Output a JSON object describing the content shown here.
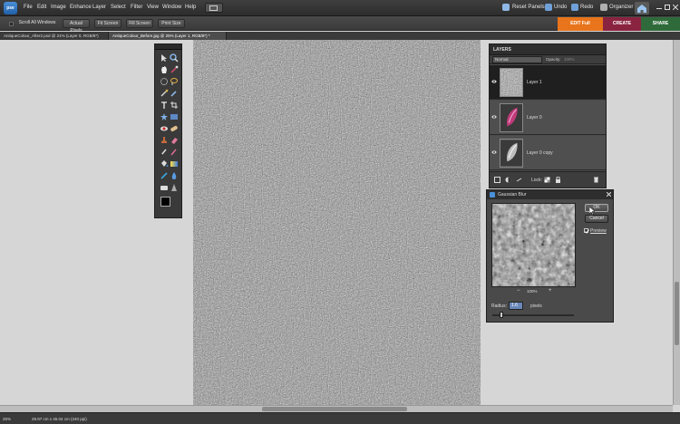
{
  "app": {
    "logo": "pse"
  },
  "menu": [
    "File",
    "Edit",
    "Image",
    "Enhance",
    "Layer",
    "Select",
    "Filter",
    "View",
    "Window",
    "Help"
  ],
  "top_right": {
    "reset_panels": "Reset Panels",
    "undo": "Undo",
    "redo": "Redo",
    "organizer": "Organizer"
  },
  "options_bar": {
    "scroll_all_windows": "Scroll All Windows",
    "actual_pixels": "Actual Pixels",
    "fit_screen": "Fit Screen",
    "fill_screen": "Fill Screen",
    "print_size": "Print Size"
  },
  "modes": {
    "edit_full": "EDIT Full",
    "create": "CREATE",
    "share": "SHARE"
  },
  "tabs": [
    {
      "label": "AntiqueColour_After2.psd @ 21% (Layer 0, RGB/8*)"
    },
    {
      "label": "AntiqueColour_Before.jpg @ 25% (Layer 1, RGB/8*) *"
    }
  ],
  "status": {
    "zoom": "25%",
    "info": "29.97 cm x 45.04 cm (240 ppi)"
  },
  "layers": {
    "title": "LAYERS",
    "blend_mode": "Normal",
    "opacity_label": "Opacity:",
    "opacity_value": "100%",
    "lock_label": "Lock:",
    "items": [
      {
        "name": "Layer 1",
        "selected": true
      },
      {
        "name": "Layer 0",
        "selected": false
      },
      {
        "name": "Layer 0 copy",
        "selected": false
      }
    ]
  },
  "gaussian_blur": {
    "title": "Gaussian Blur",
    "ok": "OK",
    "cancel": "Cancel",
    "preview_label": "Preview",
    "preview_checked": true,
    "zoom": "100%",
    "radius_label": "Radius:",
    "radius_value": "1.6",
    "units": "pixels"
  },
  "colors": {
    "accent": "#e8741b",
    "create": "#8a2340",
    "share": "#2f6b3a",
    "ui_dark": "#3a3a3a"
  },
  "icons": [
    "move-tool-icon",
    "zoom-tool-icon",
    "hand-tool-icon",
    "eyedropper-icon",
    "marquee-icon",
    "lasso-icon",
    "magic-wand-icon",
    "quick-selection-icon",
    "type-tool-icon",
    "crop-tool-icon",
    "cookie-cutter-icon",
    "straighten-icon",
    "red-eye-icon",
    "healing-brush-icon",
    "clone-stamp-icon",
    "eraser-icon",
    "brush-icon",
    "smart-brush-icon",
    "paint-bucket-icon",
    "gradient-icon",
    "custom-shape-icon",
    "blur-icon",
    "sponge-icon",
    "sharpen-icon",
    "color-swatch-icon"
  ]
}
